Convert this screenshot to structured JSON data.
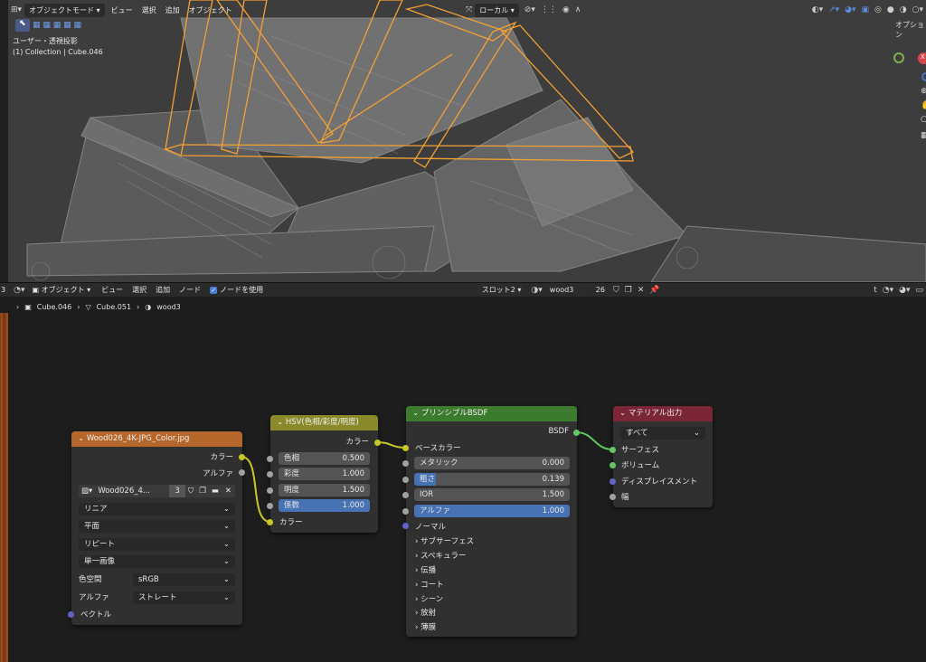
{
  "viewport": {
    "header": {
      "mode": "オブジェクトモード",
      "menu": [
        "ビュー",
        "選択",
        "追加",
        "オブジェクト"
      ],
      "transform_orientation": "ローカル"
    },
    "overlay": {
      "view_name": "ユーザー・透視投影",
      "collection_info": "(1) Collection | Cube.046"
    },
    "options_label": "オプション",
    "gizmo": {
      "x": "X"
    }
  },
  "node_editor": {
    "header": {
      "editor_number": "3",
      "mode": "オブジェクト",
      "menu": [
        "ビュー",
        "選択",
        "追加",
        "ノード"
      ],
      "use_nodes_label": "ノードを使用",
      "slot": "スロット2",
      "material_name": "wood3",
      "user_count": "26"
    },
    "breadcrumb": [
      "Cube.046",
      "Cube.051",
      "wood3"
    ],
    "image_node": {
      "title": "Wood026_4K-JPG_Color.jpg",
      "out_color": "カラー",
      "out_alpha": "アルファ",
      "image_name": "Wood026_4...",
      "image_users": "3",
      "interpolation": "リニア",
      "projection": "平面",
      "extension": "リピート",
      "source": "単一画像",
      "colorspace_label": "色空間",
      "colorspace_value": "sRGB",
      "alpha_label": "アルファ",
      "alpha_value": "ストレート",
      "in_vector": "ベクトル",
      "header_color": "#b5662a"
    },
    "hsv_node": {
      "title": "HSV(色相/彩度/明度)",
      "out_color": "カラー",
      "fields": [
        {
          "label": "色相",
          "value": "0.500"
        },
        {
          "label": "彩度",
          "value": "1.000"
        },
        {
          "label": "明度",
          "value": "1.500"
        },
        {
          "label": "係数",
          "value": "1.000"
        }
      ],
      "in_color": "カラー",
      "header_color": "#8a8a2a"
    },
    "bsdf_node": {
      "title": "プリンシプルBSDF",
      "out_bsdf": "BSDF",
      "base_color": "ベースカラー",
      "fields": [
        {
          "label": "メタリック",
          "value": "0.000"
        },
        {
          "label": "粗さ",
          "value": "0.139"
        },
        {
          "label": "IOR",
          "value": "1.500"
        },
        {
          "label": "アルファ",
          "value": "1.000"
        }
      ],
      "normal": "ノーマル",
      "panels": [
        "サブサーフェス",
        "スペキュラー",
        "伝播",
        "コート",
        "シーン",
        "放射",
        "薄膜"
      ],
      "header_color": "#3c7a2e"
    },
    "output_node": {
      "title": "マテリアル出力",
      "target": "すべて",
      "inputs": [
        "サーフェス",
        "ボリューム",
        "ディスプレイスメント",
        "幅"
      ],
      "header_color": "#7a2637"
    }
  }
}
